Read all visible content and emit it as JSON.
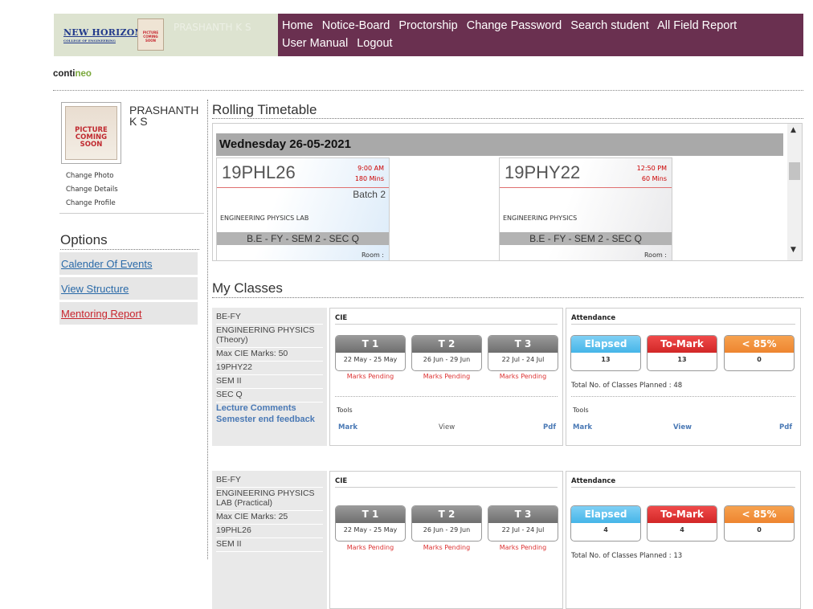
{
  "header": {
    "logo_text": "NEW HORIZON",
    "logo_subtext": "COLLEGE OF ENGINEERING",
    "picture_text": "PICTURE COMING SOON",
    "user_name": "PRASHANTH K S",
    "nav": [
      "Home",
      "Notice-Board",
      "Proctorship",
      "Change Password",
      "Search student",
      "All Field Report",
      "User Manual",
      "Logout"
    ],
    "nav_color": "#6a3050"
  },
  "brand": {
    "part1": "conti",
    "part2": "neo"
  },
  "profile": {
    "name": "PRASHANTH K S",
    "picture_lines": [
      "PICTURE",
      "COMING",
      "SOON"
    ],
    "links": [
      "Change Photo",
      "Change Details",
      "Change Profile"
    ]
  },
  "options": {
    "title": "Options",
    "items": [
      {
        "label": "Calender Of Events",
        "color": "#2a6aa8"
      },
      {
        "label": "View Structure",
        "color": "#2a6aa8"
      },
      {
        "label": "Mentoring Report",
        "color": "#c8262e"
      }
    ]
  },
  "timetable": {
    "title": "Rolling Timetable",
    "day": "Wednesday  26-05-2021",
    "cards": [
      {
        "code": "19PHL26",
        "time": "9:00 AM",
        "duration": "180 Mins",
        "batch": "Batch 2",
        "course": "ENGINEERING PHYSICS LAB",
        "section": "B.E - FY - SEM 2 - SEC Q",
        "room": "Room :"
      },
      {
        "code": "19PHY22",
        "time": "12:50 PM",
        "duration": "60 Mins",
        "batch": "",
        "course": "ENGINEERING PHYSICS",
        "section": "B.E - FY - SEM 2 - SEC Q",
        "room": "Room :"
      }
    ]
  },
  "my_classes": {
    "title": "My Classes",
    "classes": [
      {
        "program": "BE-FY",
        "course": "ENGINEERING PHYSICS (Theory)",
        "max_cie": "Max CIE Marks: 50",
        "code": "19PHY22",
        "sem": "SEM II",
        "sec": "SEC Q",
        "links": [
          "Lecture Comments",
          "Semester end feedback"
        ],
        "cie": {
          "title": "CIE",
          "tests": [
            {
              "label": "T 1",
              "dates": "22 May - 25 May",
              "status": "Marks Pending"
            },
            {
              "label": "T 2",
              "dates": "26 Jun - 29 Jun",
              "status": "Marks Pending"
            },
            {
              "label": "T 3",
              "dates": "22 Jul - 24 Jul",
              "status": "Marks Pending"
            }
          ],
          "tools_label": "Tools",
          "tools": [
            "Mark",
            "View",
            "Pdf"
          ]
        },
        "attendance": {
          "title": "Attendance",
          "tiles": [
            {
              "label": "Elapsed",
              "value": "13"
            },
            {
              "label": "To-Mark",
              "value": "13"
            },
            {
              "label": "< 85%",
              "value": "0"
            }
          ],
          "total": "Total No. of Classes Planned : 48",
          "tools_label": "Tools",
          "tools": [
            "Mark",
            "View",
            "Pdf"
          ]
        }
      },
      {
        "program": "BE-FY",
        "course": "ENGINEERING PHYSICS LAB (Practical)",
        "max_cie": "Max CIE Marks: 25",
        "code": "19PHL26",
        "sem": "SEM II",
        "sec": "",
        "links": [],
        "cie": {
          "title": "CIE",
          "tests": [
            {
              "label": "T 1",
              "dates": "22 May - 25 May",
              "status": "Marks Pending"
            },
            {
              "label": "T 2",
              "dates": "26 Jun - 29 Jun",
              "status": "Marks Pending"
            },
            {
              "label": "T 3",
              "dates": "22 Jul - 24 Jul",
              "status": "Marks Pending"
            }
          ],
          "tools_label": "",
          "tools": []
        },
        "attendance": {
          "title": "Attendance",
          "tiles": [
            {
              "label": "Elapsed",
              "value": "4"
            },
            {
              "label": "To-Mark",
              "value": "4"
            },
            {
              "label": "< 85%",
              "value": "0"
            }
          ],
          "total": "Total No. of Classes Planned : 13",
          "tools_label": "",
          "tools": []
        }
      }
    ]
  }
}
